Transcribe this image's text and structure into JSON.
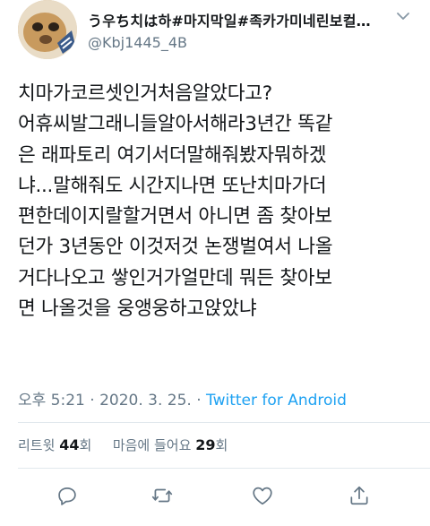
{
  "tweet": {
    "display_name": "う우ち치は하#마지막일#족카가미네린보컬…",
    "handle": "@Kbj1445_4B",
    "body_lines": [
      "치마가코르셋인거처음알았다고?",
      "어휴씨발그래니들알아서해라3년간 똑같",
      "은 래파토리 여기서더말해줘봤자뭐하겠",
      "냐...말해줘도 시간지나면 또난치마가더",
      "편한데이지랄할거면서 아니면 좀 찾아보",
      "던가 3년동안 이것저것 논쟁벌여서 나올",
      "거다나오고 쌓인거가얼만데 뭐든 찾아보",
      "면 나올것을 웅앵웅하고앉았냐"
    ],
    "time": "오후 5:21",
    "separator": "·",
    "date": "2020. 3. 25.",
    "source": "Twitter for Android",
    "retweet_label": "리트윗",
    "retweet_count": "44",
    "retweet_unit": "회",
    "like_label": "마음에 들어요",
    "like_count": "29",
    "like_unit": "회"
  },
  "icons": {
    "caret": "chevron-down-icon",
    "reply": "reply-icon",
    "retweet": "retweet-icon",
    "like": "heart-icon",
    "share": "share-icon"
  },
  "colors": {
    "text": "#14171a",
    "secondary": "#657786",
    "accent": "#1da1f2",
    "border": "#e1e8ed"
  }
}
